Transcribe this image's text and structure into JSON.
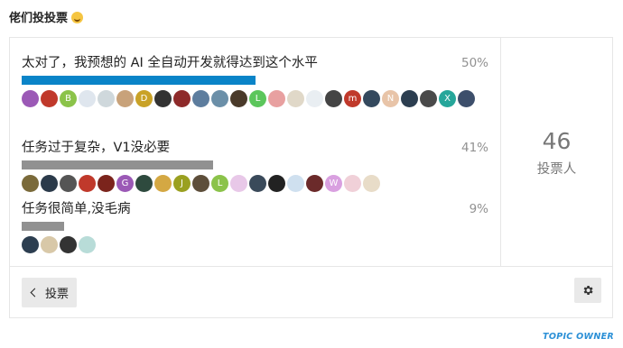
{
  "title": "佬们投投票",
  "poll": {
    "options": [
      {
        "label": "太对了，我预想的 AI 全自动开发就得达到这个水平",
        "percent_text": "50%",
        "percent": 50,
        "bar_color": "#0a84c8",
        "voters": [
          {
            "color": "#9b59b6",
            "letter": ""
          },
          {
            "color": "#c0392b",
            "letter": ""
          },
          {
            "color": "#8bc34a",
            "letter": "B"
          },
          {
            "color": "#dfe6ee",
            "letter": ""
          },
          {
            "color": "#cfd8dc",
            "letter": ""
          },
          {
            "color": "#c8a27a",
            "letter": ""
          },
          {
            "color": "#c9a227",
            "letter": "D"
          },
          {
            "color": "#333333",
            "letter": ""
          },
          {
            "color": "#8e2a2a",
            "letter": ""
          },
          {
            "color": "#5d7d9e",
            "letter": ""
          },
          {
            "color": "#6b8fa8",
            "letter": ""
          },
          {
            "color": "#4a3a2a",
            "letter": ""
          },
          {
            "color": "#5cc65c",
            "letter": "L"
          },
          {
            "color": "#e8a0a0",
            "letter": ""
          },
          {
            "color": "#e0d8c8",
            "letter": ""
          },
          {
            "color": "#e9eef2",
            "letter": ""
          },
          {
            "color": "#444444",
            "letter": ""
          },
          {
            "color": "#c0392b",
            "letter": "m"
          },
          {
            "color": "#34495e",
            "letter": ""
          },
          {
            "color": "#e8c4a8",
            "letter": "N"
          },
          {
            "color": "#2c3e50",
            "letter": ""
          },
          {
            "color": "#4a4a4a",
            "letter": ""
          },
          {
            "color": "#26a69a",
            "letter": "X"
          },
          {
            "color": "#3d4f6b",
            "letter": ""
          }
        ]
      },
      {
        "label": "任务过于复杂，V1没必要",
        "percent_text": "41%",
        "percent": 41,
        "bar_color": "#919191",
        "voters": [
          {
            "color": "#7a6a3a",
            "letter": ""
          },
          {
            "color": "#2b3a4a",
            "letter": ""
          },
          {
            "color": "#555555",
            "letter": ""
          },
          {
            "color": "#c0392b",
            "letter": ""
          },
          {
            "color": "#7b241c",
            "letter": ""
          },
          {
            "color": "#9b59b6",
            "letter": "G"
          },
          {
            "color": "#2e4a3e",
            "letter": ""
          },
          {
            "color": "#d4a843",
            "letter": ""
          },
          {
            "color": "#9aa020",
            "letter": "J"
          },
          {
            "color": "#5d4e3a",
            "letter": ""
          },
          {
            "color": "#8bc34a",
            "letter": "L"
          },
          {
            "color": "#e8c8e8",
            "letter": ""
          },
          {
            "color": "#3a4a5a",
            "letter": ""
          },
          {
            "color": "#222222",
            "letter": ""
          },
          {
            "color": "#cfe0ef",
            "letter": ""
          },
          {
            "color": "#6b2a2a",
            "letter": ""
          },
          {
            "color": "#d9a0e0",
            "letter": "W"
          },
          {
            "color": "#f0d0d8",
            "letter": ""
          },
          {
            "color": "#e8dcc8",
            "letter": ""
          }
        ]
      },
      {
        "label": "任务很简单,没毛病",
        "percent_text": "9%",
        "percent": 9,
        "bar_color": "#919191",
        "voters": [
          {
            "color": "#2c3e50",
            "letter": ""
          },
          {
            "color": "#d8c8a8",
            "letter": ""
          },
          {
            "color": "#333333",
            "letter": ""
          },
          {
            "color": "#b8dcd8",
            "letter": ""
          }
        ]
      }
    ],
    "voter_count": "46",
    "voter_count_label": "投票人",
    "back_button_label": "投票"
  },
  "topic_owner_label": "TOPIC OWNER"
}
